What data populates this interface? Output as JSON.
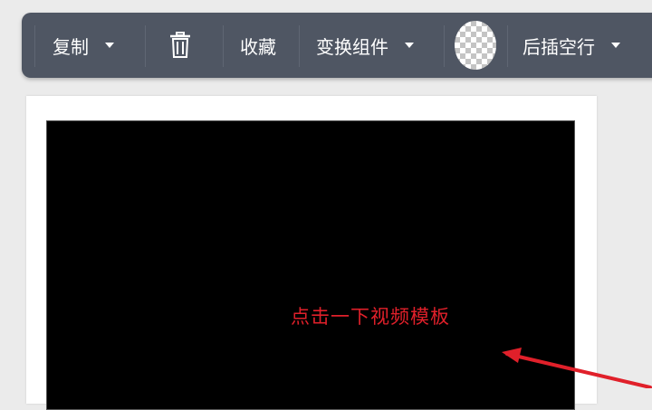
{
  "toolbar": {
    "copy_label": "复制",
    "delete_icon": "trash-icon",
    "favorite_label": "收藏",
    "transform_label": "变换组件",
    "avatar_icon": "transparency-checker-icon",
    "insert_label": "后插空行"
  },
  "canvas": {
    "hint_text": "点击一下视频模板",
    "hint_color": "#e0202a"
  },
  "colors": {
    "toolbar_bg": "#4f5663",
    "page_bg": "#ebebeb",
    "video_bg": "#000000",
    "arrow": "#e0202a"
  }
}
